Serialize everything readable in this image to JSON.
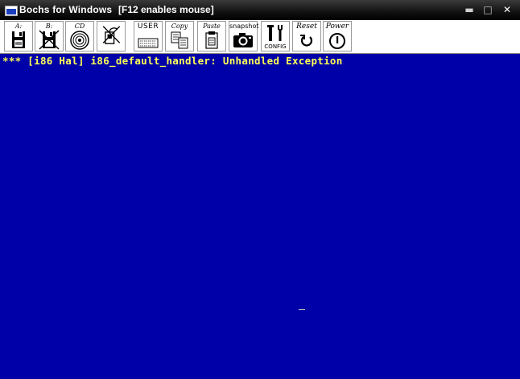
{
  "window": {
    "title": "Bochs for Windows",
    "title_hint": "[F12 enables mouse]",
    "controls": {
      "minimize": "▬",
      "maximize": "□",
      "close": "✕"
    }
  },
  "toolbar": {
    "buttons": [
      {
        "label": "A:",
        "icon": "floppy-a-icon"
      },
      {
        "label": "B:",
        "icon": "floppy-b-icon"
      },
      {
        "label": "CD",
        "icon": "cdrom-icon"
      },
      {
        "label": "",
        "icon": "disabled-device-icon"
      },
      {
        "label": "USER",
        "icon": "keyboard-icon"
      },
      {
        "label": "Copy",
        "icon": "copy-icon"
      },
      {
        "label": "Paste",
        "icon": "paste-icon"
      },
      {
        "label": "snapshot",
        "icon": "camera-icon"
      },
      {
        "label": "CONFIG",
        "icon": "tools-icon"
      },
      {
        "label": "Reset",
        "icon": "reset-icon"
      },
      {
        "label": "Power",
        "icon": "power-icon"
      }
    ]
  },
  "console": {
    "background": "#0000a8",
    "text_color": "#ffff55",
    "line": "*** [i86 Hal] i86_default_handler: Unhandled Exception"
  }
}
